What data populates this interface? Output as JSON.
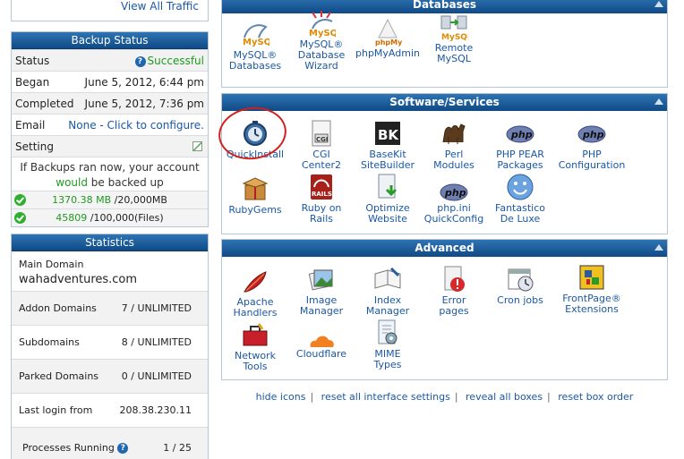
{
  "traffic": {
    "view_all": "View All Traffic"
  },
  "backup": {
    "title": "Backup Status",
    "status_label": "Status",
    "status_value": "Successful",
    "began_label": "Began",
    "began_value": "June 5, 2012, 6:44 pm",
    "completed_label": "Completed",
    "completed_value": "June 5, 2012, 7:36 pm",
    "email_label": "Email",
    "email_value": "None - Click to configure.",
    "setting_label": "Setting",
    "if_line1": "If Backups ran now, your account",
    "if_would": "would",
    "if_line2_rest": "be backed up",
    "mb_used": "1370.38 MB",
    "mb_total": "/20,000MB",
    "files_used": "45809",
    "files_total": "/100,000(Files)"
  },
  "stats": {
    "title": "Statistics",
    "main_domain_label": "Main Domain",
    "main_domain_value": "wahadventures.com",
    "addon_label": "Addon Domains",
    "addon_value": "7 / UNLIMITED",
    "sub_label": "Subdomains",
    "sub_value": "8 / UNLIMITED",
    "parked_label": "Parked Domains",
    "parked_value": "0 / UNLIMITED",
    "login_label": "Last login from",
    "login_value": "208.38.230.11",
    "proc_label": "Processes Running",
    "proc_value": "1 / 25"
  },
  "databases": {
    "title": "Databases",
    "items": [
      {
        "l1": "MySQL®",
        "l2": "Databases",
        "l3": ""
      },
      {
        "l1": "MySQL®",
        "l2": "Database",
        "l3": "Wizard"
      },
      {
        "l1": "phpMyAdmin",
        "l2": "",
        "l3": ""
      },
      {
        "l1": "Remote",
        "l2": "MySQL",
        "l3": ""
      }
    ]
  },
  "software": {
    "title": "Software/Services",
    "items": [
      {
        "l1": "QuickInstall",
        "l2": ""
      },
      {
        "l1": "CGI",
        "l2": "Center2"
      },
      {
        "l1": "BaseKit",
        "l2": "SiteBuilder"
      },
      {
        "l1": "Perl",
        "l2": "Modules"
      },
      {
        "l1": "PHP PEAR",
        "l2": "Packages"
      },
      {
        "l1": "PHP",
        "l2": "Configuration"
      },
      {
        "l1": "RubyGems",
        "l2": ""
      },
      {
        "l1": "Ruby on",
        "l2": "Rails"
      },
      {
        "l1": "Optimize",
        "l2": "Website"
      },
      {
        "l1": "php.ini",
        "l2": "QuickConfig"
      },
      {
        "l1": "Fantastico",
        "l2": "De Luxe"
      }
    ]
  },
  "advanced": {
    "title": "Advanced",
    "items": [
      {
        "l1": "Apache",
        "l2": "Handlers"
      },
      {
        "l1": "Image",
        "l2": "Manager"
      },
      {
        "l1": "Index",
        "l2": "Manager"
      },
      {
        "l1": "Error",
        "l2": "pages"
      },
      {
        "l1": "Cron jobs",
        "l2": ""
      },
      {
        "l1": "FrontPage®",
        "l2": "Extensions"
      },
      {
        "l1": "Network",
        "l2": "Tools"
      },
      {
        "l1": "Cloudflare",
        "l2": ""
      },
      {
        "l1": "MIME",
        "l2": "Types"
      }
    ]
  },
  "icon_text": {
    "mysql": "MySQL",
    "php": "php",
    "phpmyadmin": "phpMyAdmin",
    "cgi": "CGI",
    "bk": "BK",
    "rails": "RAILS"
  },
  "footer": {
    "hide_icons": "hide icons",
    "reset_settings": "reset all interface settings",
    "reveal_boxes": "reveal all boxes",
    "reset_order": "reset box order",
    "sep": "|"
  },
  "colors": {
    "header": "#1b5b99",
    "link": "#1a58a5",
    "success": "#1e9a1e",
    "annotation": "#d21f1f"
  }
}
